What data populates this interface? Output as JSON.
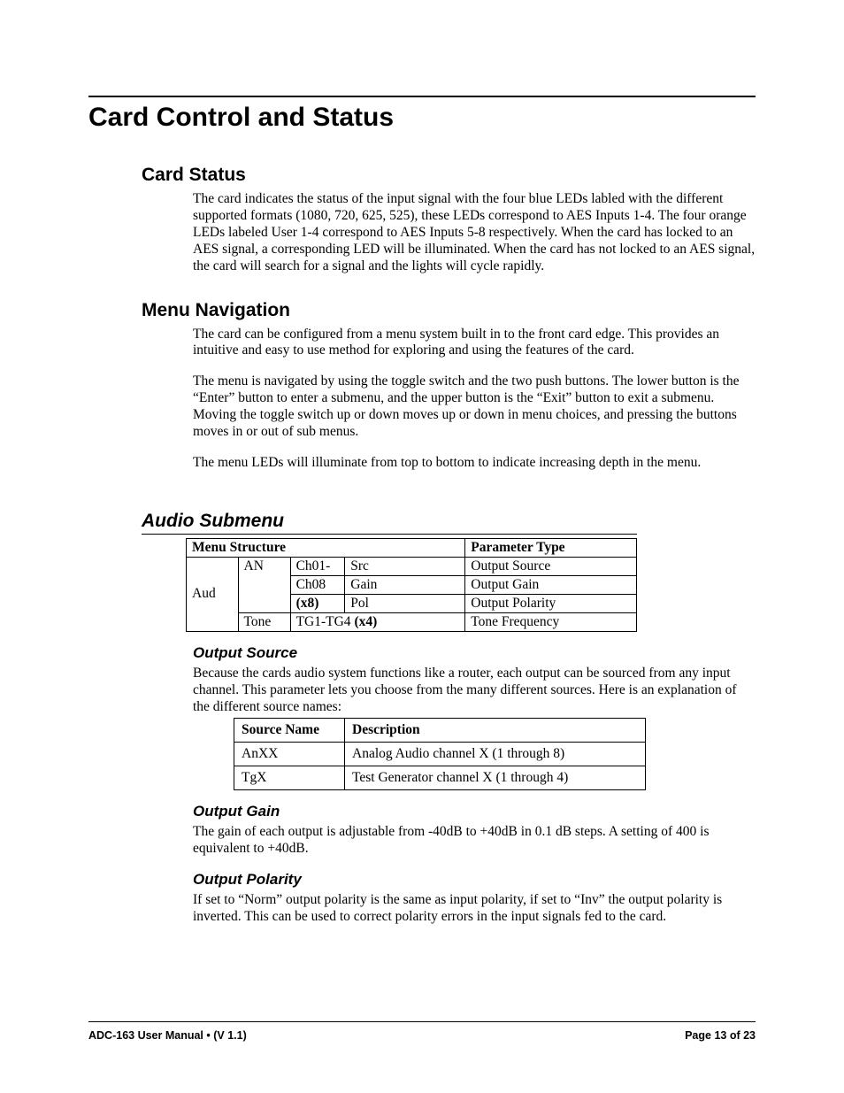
{
  "title": "Card Control and Status",
  "sections": {
    "card_status": {
      "heading": "Card Status",
      "p1": "The card indicates the status of the input signal with the four blue LEDs labled with the different supported formats (1080, 720, 625, 525), these LEDs correspond to AES Inputs 1-4. The four orange LEDs labeled User 1-4 correspond to AES Inputs 5-8 respectively.  When the card has locked to an AES signal, a corresponding LED will be illuminated. When the card has not locked to an AES signal, the card will search for a signal and the lights will cycle rapidly."
    },
    "menu_nav": {
      "heading": "Menu Navigation",
      "p1": "The card can be configured from a menu system built in to the front card edge. This provides an intuitive and easy to use method for exploring and using the features of the card.",
      "p2": "The menu is navigated by using the toggle switch and the two push buttons. The lower button is the “Enter” button to enter a submenu, and the upper button is the “Exit” button to exit a submenu. Moving the toggle switch up or down moves up or down in menu choices, and pressing the buttons moves in or out of sub menus.",
      "p3": "The menu LEDs will illuminate from top to bottom to indicate increasing depth in the menu."
    },
    "audio": {
      "heading": "Audio Submenu",
      "table_headers": {
        "structure": "Menu Structure",
        "ptype": "Parameter Type"
      },
      "rows": {
        "aud": "Aud",
        "an": "AN",
        "ch_a": "Ch01-",
        "ch_b": "Ch08",
        "ch_c_pre": "(x8)",
        "src": "Src",
        "src_p": "Output Source",
        "gain": "Gain",
        "gain_p": "Output Gain",
        "pol": "Pol",
        "pol_p": "Output Polarity",
        "tone": "Tone",
        "tg": "TG1-TG4 ",
        "tg_b": "(x4)",
        "tg_p": "Tone Frequency"
      },
      "output_source": {
        "heading": "Output Source",
        "p1": "Because the cards audio system functions like a router, each output can be sourced from any input channel. This parameter lets you choose from the many different sources. Here is an explanation of the different source names:",
        "th1": "Source Name",
        "th2": "Description",
        "r1c1": "AnXX",
        "r1c2": "Analog Audio channel X (1 through 8)",
        "r2c1": "TgX",
        "r2c2": "Test Generator channel X (1 through 4)"
      },
      "output_gain": {
        "heading": "Output Gain",
        "p1": "The gain of each output is adjustable from -40dB to +40dB in 0.1 dB steps.  A setting of 400 is equivalent to +40dB."
      },
      "output_polarity": {
        "heading": "Output Polarity",
        "p1": "If set to “Norm” output polarity is the same as input polarity, if set to “Inv” the output polarity is inverted. This can be used to correct polarity errors in the input signals fed to the card."
      }
    }
  },
  "footer": {
    "left_a": "ADC-163 User Manual  ",
    "left_b": "•",
    "left_c": "  (V 1.1)",
    "right": "Page 13 of 23"
  }
}
